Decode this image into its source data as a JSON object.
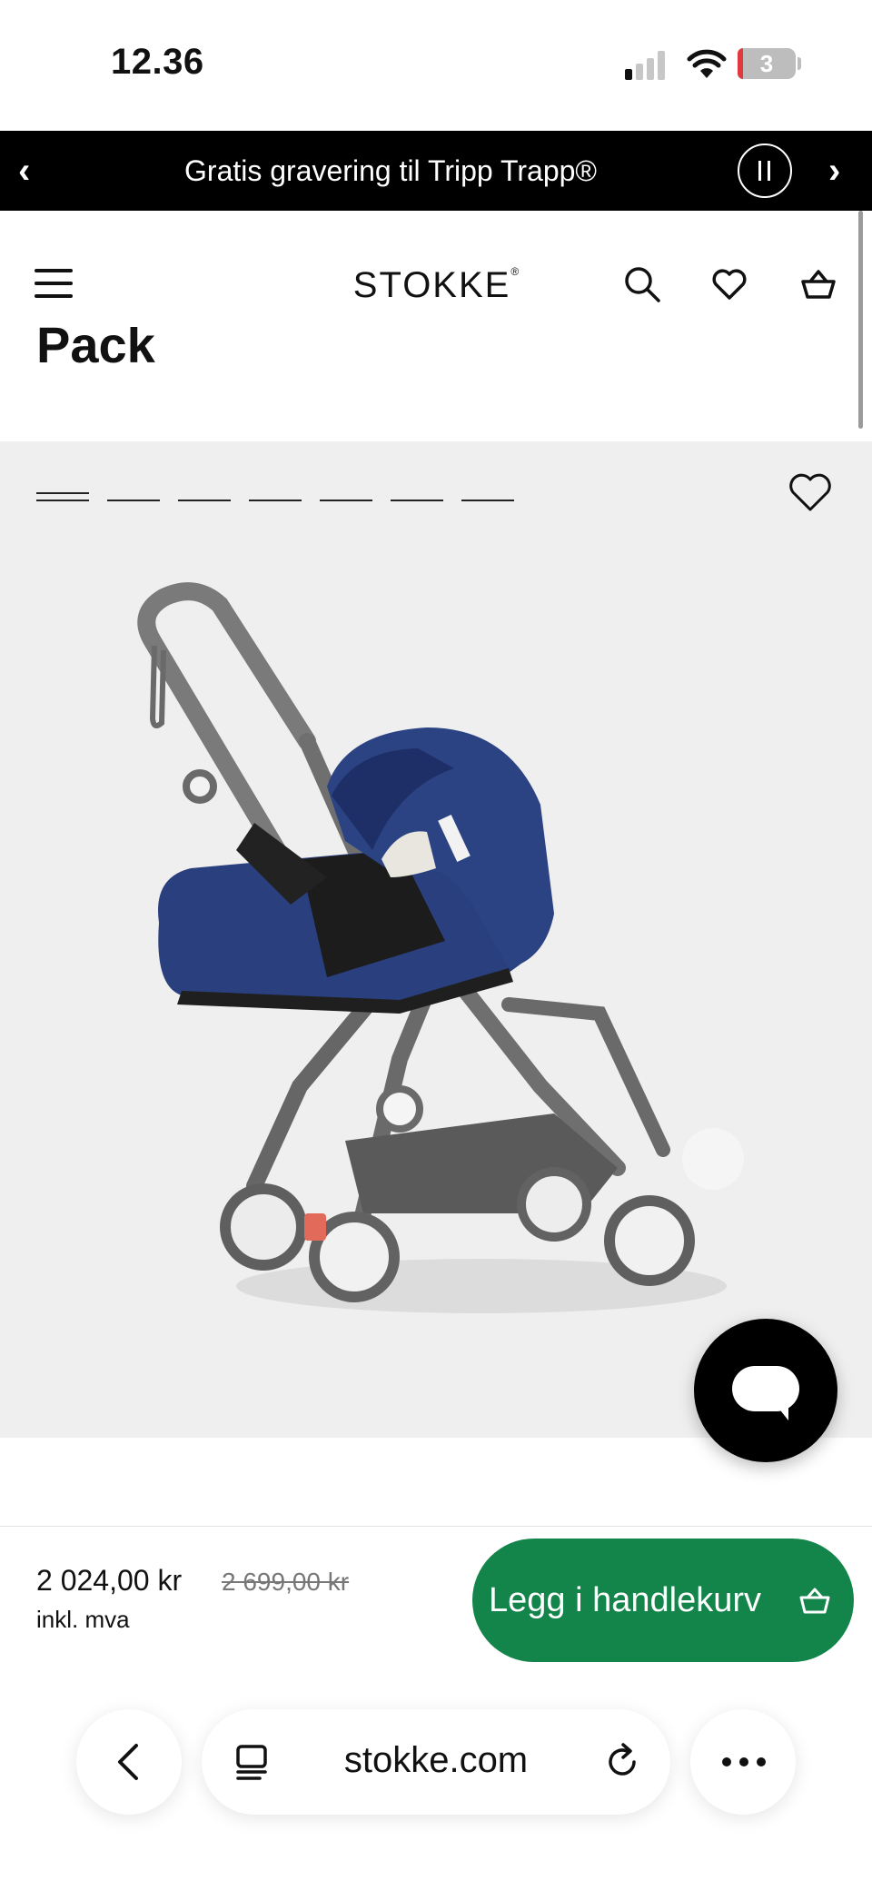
{
  "status_bar": {
    "time": "12.36",
    "battery_level": "3",
    "signal_bars_active": 1,
    "signal_bars_total": 4
  },
  "promo": {
    "text": "Gratis gravering til Tripp Trapp®",
    "prev_icon": "chevron-left-icon",
    "next_icon": "chevron-right-icon",
    "pause_icon": "pause-icon"
  },
  "header": {
    "logo_text": "STOKKE",
    "logo_mark": "®",
    "icons": [
      "menu-icon",
      "search-icon",
      "heart-icon",
      "basket-icon"
    ]
  },
  "product": {
    "title_fragment": "Pack",
    "gallery_image_count": 7,
    "gallery_active_index": 0,
    "image_description_icon": "stroller-image"
  },
  "purchase": {
    "price": "2 024,00 kr",
    "old_price": "2 699,00 kr",
    "vat_note": "inkl. mva",
    "cart_button_label": "Legg i handlekurv"
  },
  "browser": {
    "url": "stokke.com",
    "icons": [
      "back-icon",
      "tabs-icon",
      "reload-icon",
      "more-icon"
    ]
  },
  "colors": {
    "promo_bg": "#000000",
    "cart_button": "#13854b",
    "gallery_bg": "#efefef",
    "canopy_blue": "#243a78"
  }
}
